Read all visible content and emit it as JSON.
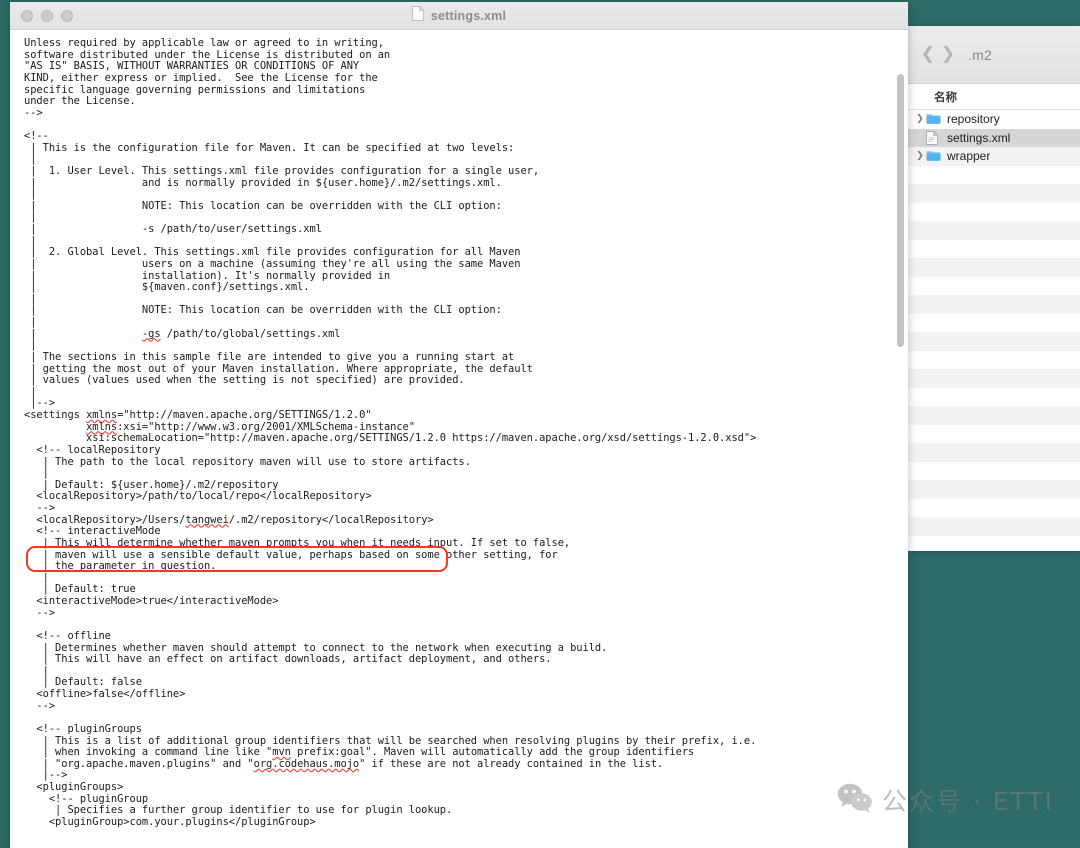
{
  "desktop": {
    "background_color": "#2d6b66"
  },
  "editor_window": {
    "title": "settings.xml",
    "title_icon": "document-icon",
    "traffic_lights": [
      "close-button",
      "minimize-button",
      "zoom-button"
    ],
    "scrollbar": {
      "orientation": "vertical"
    },
    "annotation": {
      "type": "red-rounded-rectangle-highlight",
      "color": "#ee3b24",
      "target_line": "<localRepository>/Users/tangwei/.m2/repository</localRepository>"
    },
    "code": "Unless required by applicable law or agreed to in writing,\nsoftware distributed under the License is distributed on an\n\"AS IS\" BASIS, WITHOUT WARRANTIES OR CONDITIONS OF ANY\nKIND, either express or implied.  See the License for the\nspecific language governing permissions and limitations\nunder the License.\n-->\n\n<!--\n | This is the configuration file for Maven. It can be specified at two levels:\n |\n |  1. User Level. This settings.xml file provides configuration for a single user,\n |                 and is normally provided in ${user.home}/.m2/settings.xml.\n |\n |                 NOTE: This location can be overridden with the CLI option:\n |\n |                 -s /path/to/user/settings.xml\n |\n |  2. Global Level. This settings.xml file provides configuration for all Maven\n |                 users on a machine (assuming they're all using the same Maven\n |                 installation). It's normally provided in\n |                 ${maven.conf}/settings.xml.\n |\n |                 NOTE: This location can be overridden with the CLI option:\n |\n |                 -gs /path/to/global/settings.xml\n |\n | The sections in this sample file are intended to give you a running start at\n | getting the most out of your Maven installation. Where appropriate, the default\n | values (values used when the setting is not specified) are provided.\n |\n |-->\n<settings xmlns=\"http://maven.apache.org/SETTINGS/1.2.0\"\n          xmlns:xsi=\"http://www.w3.org/2001/XMLSchema-instance\"\n          xsi:schemaLocation=\"http://maven.apache.org/SETTINGS/1.2.0 https://maven.apache.org/xsd/settings-1.2.0.xsd\">\n  <!-- localRepository\n   | The path to the local repository maven will use to store artifacts.\n   |\n   | Default: ${user.home}/.m2/repository\n  <localRepository>/path/to/local/repo</localRepository>\n  -->\n  <localRepository>/Users/tangwei/.m2/repository</localRepository>\n  <!-- interactiveMode\n   | This will determine whether maven prompts you when it needs input. If set to false,\n   | maven will use a sensible default value, perhaps based on some other setting, for\n   | the parameter in question.\n   |\n   | Default: true\n  <interactiveMode>true</interactiveMode>\n  -->\n\n  <!-- offline\n   | Determines whether maven should attempt to connect to the network when executing a build.\n   | This will have an effect on artifact downloads, artifact deployment, and others.\n   |\n   | Default: false\n  <offline>false</offline>\n  -->\n\n  <!-- pluginGroups\n   | This is a list of additional group identifiers that will be searched when resolving plugins by their prefix, i.e.\n   | when invoking a command line like \"mvn prefix:goal\". Maven will automatically add the group identifiers\n   | \"org.apache.maven.plugins\" and \"org.codehaus.mojo\" if these are not already contained in the list.\n   |-->\n  <pluginGroups>\n    <!-- pluginGroup\n     | Specifies a further group identifier to use for plugin lookup.\n    <pluginGroup>com.your.plugins</pluginGroup>"
  },
  "finder_window": {
    "nav": {
      "back_icon": "chevron-left-icon",
      "forward_icon": "chevron-right-icon"
    },
    "path_title": ".m2",
    "column_header": "名称",
    "items": [
      {
        "label": "repository",
        "kind": "folder",
        "icon": "folder-icon",
        "expandable": true,
        "selected": false
      },
      {
        "label": "settings.xml",
        "kind": "file",
        "icon": "document-icon",
        "expandable": false,
        "selected": true
      },
      {
        "label": "wrapper",
        "kind": "folder",
        "icon": "folder-icon",
        "expandable": true,
        "selected": false
      }
    ]
  },
  "watermark": {
    "icon": "wechat-icon",
    "text": "公众号 · ETTI"
  }
}
